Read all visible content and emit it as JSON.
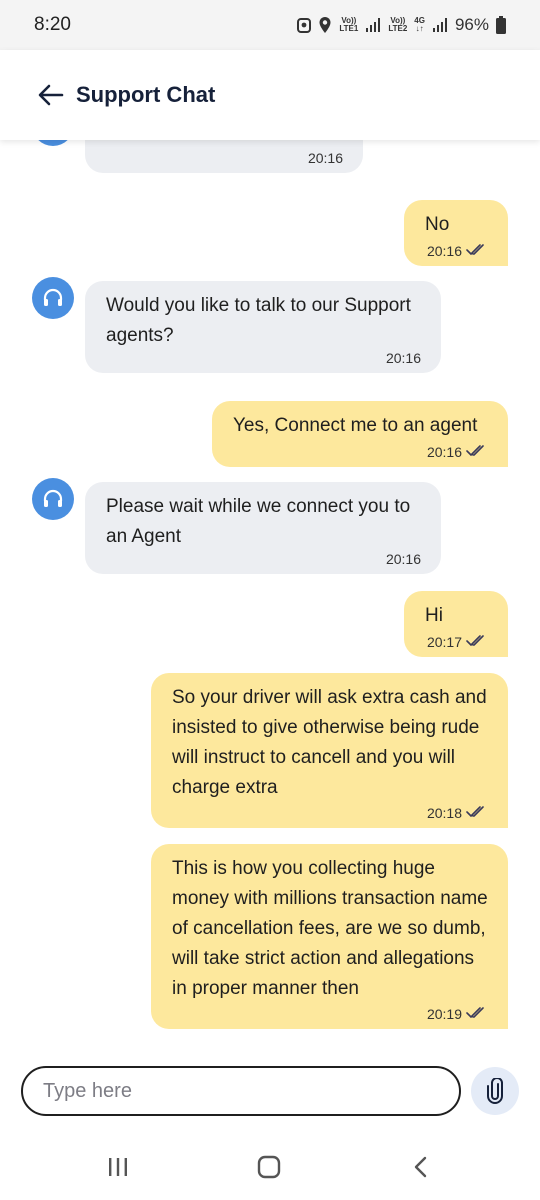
{
  "status_bar": {
    "time": "8:20",
    "sim1_line1": "Vo))",
    "sim1_line2": "LTE1",
    "sim2_line1": "Vo))",
    "sim2_line2": "LTE2",
    "network": "4G",
    "battery": "96%"
  },
  "header": {
    "title": "Support Chat",
    "back_icon": "arrow-left-icon"
  },
  "messages": [
    {
      "sender": "bot",
      "text": "",
      "time": "20:16"
    },
    {
      "sender": "user",
      "text": "No",
      "time": "20:16",
      "read": true
    },
    {
      "sender": "bot",
      "text": "Would you like to talk to our Support agents?",
      "time": "20:16"
    },
    {
      "sender": "user",
      "text": "Yes, Connect me to an agent",
      "time": "20:16",
      "read": true
    },
    {
      "sender": "bot",
      "text": "Please wait while we connect you to an Agent",
      "time": "20:16"
    },
    {
      "sender": "user",
      "text": "Hi",
      "time": "20:17",
      "read": true
    },
    {
      "sender": "user",
      "text": "So your driver will ask extra cash and insisted to give otherwise being rude will instruct to cancell and you will charge extra",
      "time": "20:18",
      "read": true
    },
    {
      "sender": "user",
      "text": "This is how you collecting huge money with millions transaction name of cancellation fees, are we so dumb, will take strict action and allegations in proper manner then",
      "time": "20:19",
      "read": true
    }
  ],
  "composer": {
    "placeholder": "Type here",
    "attach_icon": "paperclip-icon"
  },
  "nav": {
    "recents_icon": "recents-icon",
    "home_icon": "home-icon",
    "back_icon": "back-chevron-icon"
  },
  "colors": {
    "user_bubble": "#fde89d",
    "bot_bubble": "#eceef2",
    "avatar": "#4a8fe0",
    "title": "#16213a"
  }
}
